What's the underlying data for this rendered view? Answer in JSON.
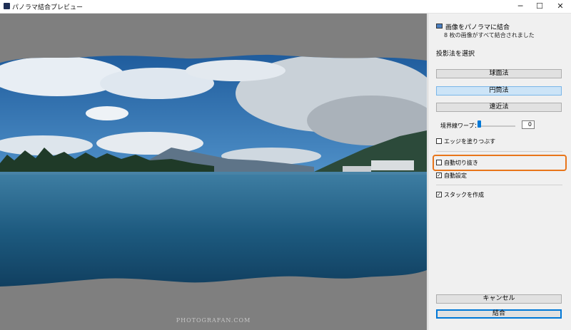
{
  "window": {
    "title": "パノラマ結合プレビュー",
    "minimize_glyph": "─",
    "maximize_glyph": "☐",
    "close_glyph": "✕"
  },
  "preview": {
    "watermark": "PHOTOGRAFAN.COM"
  },
  "panel": {
    "merge_title": "画像をパノラマに結合",
    "merge_subtitle": "8 枚の画像がすべて結合されました",
    "projection_label": "投影法を選択",
    "projection_buttons": [
      {
        "label": "球面法",
        "selected": false
      },
      {
        "label": "円筒法",
        "selected": true
      },
      {
        "label": "遠近法",
        "selected": false
      }
    ],
    "boundary_warp_label": "境界線ワープ：",
    "boundary_warp_value": "0",
    "fill_edges": {
      "label": "エッジを塗りつぶす",
      "checked": false,
      "mark": ""
    },
    "auto_crop": {
      "label": "自動切り抜き",
      "checked": false,
      "mark": ""
    },
    "auto_settings": {
      "label": "自動設定",
      "checked": true,
      "mark": "✓"
    },
    "create_stack": {
      "label": "スタックを作成",
      "checked": true,
      "mark": "✓"
    },
    "cancel_label": "キャンセル",
    "merge_label": "結合"
  },
  "colors": {
    "accent": "#0078d7",
    "highlight": "#e8751a",
    "preview_bg": "#7f7f7f"
  }
}
